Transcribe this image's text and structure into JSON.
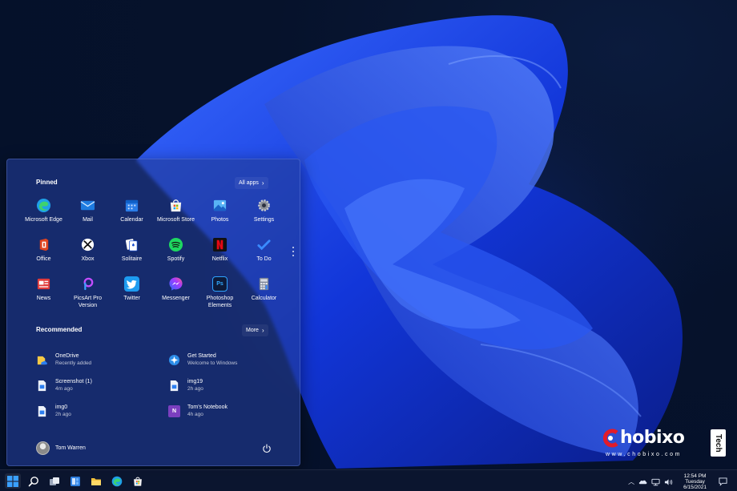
{
  "start_menu": {
    "pinned_title": "Pinned",
    "all_apps_label": "All apps",
    "recommended_title": "Recommended",
    "more_label": "More",
    "pinned_apps": [
      {
        "label": "Microsoft Edge",
        "icon": "edge-icon"
      },
      {
        "label": "Mail",
        "icon": "mail-icon"
      },
      {
        "label": "Calendar",
        "icon": "calendar-icon"
      },
      {
        "label": "Microsoft Store",
        "icon": "store-icon"
      },
      {
        "label": "Photos",
        "icon": "photos-icon"
      },
      {
        "label": "Settings",
        "icon": "gear-icon"
      },
      {
        "label": "Office",
        "icon": "office-icon"
      },
      {
        "label": "Xbox",
        "icon": "xbox-icon"
      },
      {
        "label": "Solitaire",
        "icon": "solitaire-icon"
      },
      {
        "label": "Spotify",
        "icon": "spotify-icon"
      },
      {
        "label": "Netflix",
        "icon": "netflix-icon"
      },
      {
        "label": "To Do",
        "icon": "todo-icon"
      },
      {
        "label": "News",
        "icon": "news-icon"
      },
      {
        "label": "PicsArt Pro Version",
        "icon": "picsart-icon"
      },
      {
        "label": "Twitter",
        "icon": "twitter-icon"
      },
      {
        "label": "Messenger",
        "icon": "messenger-icon"
      },
      {
        "label": "Photoshop Elements",
        "icon": "photoshop-icon",
        "glyph": "Ps"
      },
      {
        "label": "Calculator",
        "icon": "calculator-icon"
      }
    ],
    "recommended": [
      {
        "name": "OneDrive",
        "sub": "Recently added",
        "icon": "onedrive-icon"
      },
      {
        "name": "Get Started",
        "sub": "Welcome to Windows",
        "icon": "get-started-icon"
      },
      {
        "name": "Screenshot (1)",
        "sub": "4m ago",
        "icon": "image-file-icon"
      },
      {
        "name": "img19",
        "sub": "2h ago",
        "icon": "image-file-icon"
      },
      {
        "name": "img0",
        "sub": "2h ago",
        "icon": "image-file-icon"
      },
      {
        "name": "Tom's Notebook",
        "sub": "4h ago",
        "icon": "onenote-icon",
        "glyph": "N"
      }
    ],
    "user_name": "Tom Warren",
    "power_icon": "power-icon"
  },
  "taskbar": {
    "icons": [
      "windows-start-icon",
      "search-icon",
      "task-view-icon",
      "widgets-icon",
      "file-explorer-icon",
      "edge-icon",
      "store-icon"
    ],
    "tray": {
      "time": "12:54 PM",
      "day": "Tuesday",
      "date": "6/15/2021",
      "icons": [
        "chevron-up-icon",
        "onedrive-cloud-icon",
        "network-icon",
        "volume-icon",
        "notification-icon"
      ]
    }
  },
  "watermark": {
    "brand": "hobixo",
    "tag": "Tech",
    "url": "www.chobixo.com"
  },
  "colors": {
    "accent": "#2f6bff",
    "menu_bg": "#223c96",
    "taskbar_bg": "#0c1630"
  }
}
